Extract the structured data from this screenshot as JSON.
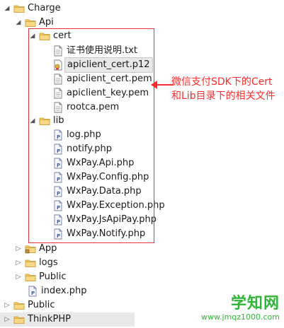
{
  "tree": {
    "charge": "Charge",
    "api": "Api",
    "cert": "cert",
    "cert_files": [
      "证书使用说明.txt",
      "apiclient_cert.p12",
      "apiclient_cert.pem",
      "apiclient_key.pem",
      "rootca.pem"
    ],
    "lib": "lib",
    "lib_files": [
      "log.php",
      "notify.php",
      "WxPay.Api.php",
      "WxPay.Config.php",
      "WxPay.Data.php",
      "WxPay.Exception.php",
      "WxPay.JsApiPay.php",
      "WxPay.Notify.php"
    ],
    "app": "App",
    "logs": "logs",
    "public_inner": "Public",
    "index": "index.php",
    "public_outer": "Public",
    "thinkphp": "ThinkPHP"
  },
  "annotation": "微信支付SDK下的Cert和Lib目录下的相关文件",
  "watermark": {
    "main": "学知网",
    "url": "www.jmqz1000.com"
  },
  "colors": {
    "annotation": "#ff2a2a",
    "box": "#e8333b",
    "watermark": "#31b539"
  }
}
